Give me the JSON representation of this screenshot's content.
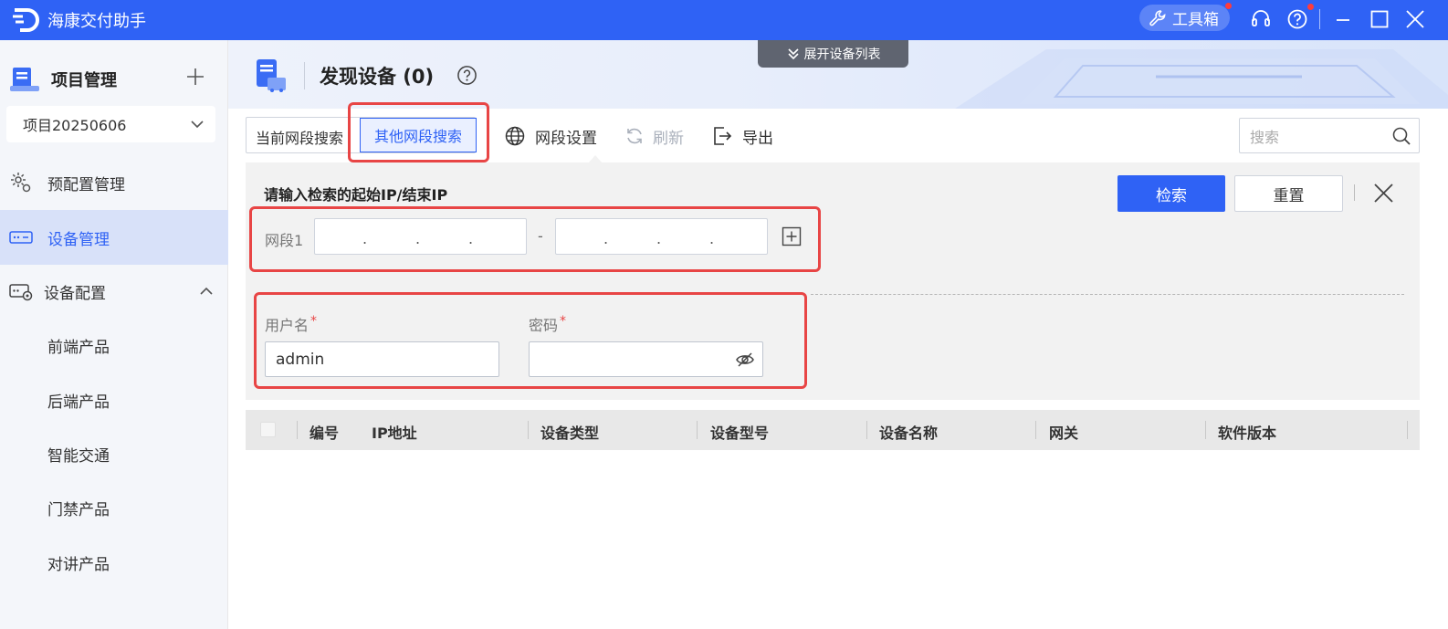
{
  "app": {
    "title": "海康交付助手",
    "toolbox_label": "工具箱",
    "brand_color": "#2f62f5"
  },
  "sidebar": {
    "project_title": "项目管理",
    "project_selected": "项目20250606",
    "items": [
      {
        "label": "预配置管理",
        "icon": "gear-settings-icon"
      },
      {
        "label": "设备管理",
        "icon": "device-icon",
        "active": true
      },
      {
        "label": "设备配置",
        "icon": "device-config-icon",
        "expanded": true
      }
    ],
    "sub_items": [
      {
        "label": "前端产品"
      },
      {
        "label": "后端产品"
      },
      {
        "label": "智能交通"
      },
      {
        "label": "门禁产品"
      },
      {
        "label": "对讲产品"
      }
    ]
  },
  "header": {
    "expand_tab_label": "展开设备列表",
    "page_title": "发现设备 (0)"
  },
  "toolbar": {
    "tabs": [
      {
        "label": "当前网段搜索"
      },
      {
        "label": "其他网段搜索",
        "selected": true
      }
    ],
    "segment_settings": "网段设置",
    "refresh": "刷新",
    "export": "导出",
    "search_placeholder": "搜索"
  },
  "search_panel": {
    "ip_prompt": "请输入检索的起始IP/结束IP",
    "search_button": "检索",
    "reset_button": "重置",
    "segment_label": "网段1",
    "ip_separator": "-",
    "username_label": "用户名",
    "username_value": "admin",
    "password_label": "密码",
    "required_mark": "*"
  },
  "table": {
    "columns": [
      "编号",
      "IP地址",
      "设备类型",
      "设备型号",
      "设备名称",
      "网关",
      "软件版本"
    ]
  }
}
